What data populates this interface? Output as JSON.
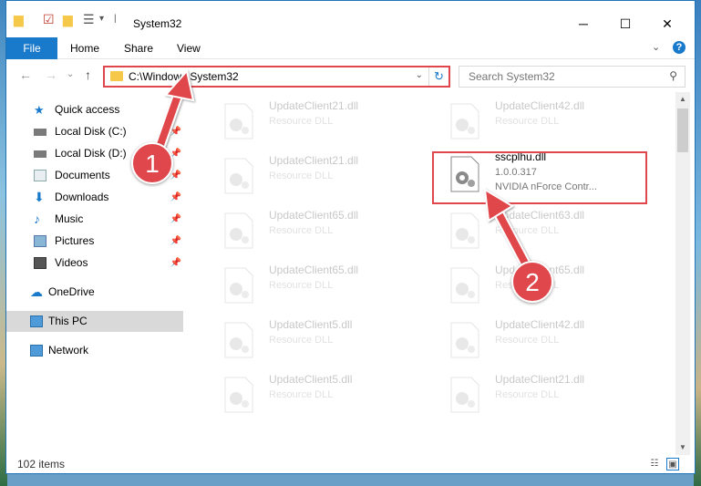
{
  "window": {
    "title": "System32",
    "minimize": "─",
    "maximize": "☐",
    "close": "✕"
  },
  "ribbon": {
    "tabs": [
      "File",
      "Home",
      "Share",
      "View"
    ],
    "expand_glyph": "⌄",
    "help_glyph": "?"
  },
  "nav": {
    "back_glyph": "←",
    "forward_glyph": "→",
    "recent_glyph": "⌄",
    "up_glyph": "↑",
    "address": "C:\\Windows\\System32",
    "search_placeholder": "Search System32"
  },
  "sidebar": {
    "items": [
      {
        "label": "Quick access",
        "icon": "star-icon",
        "pinned": false
      },
      {
        "label": "Local Disk (C:)",
        "icon": "drive-icon",
        "pinned": true
      },
      {
        "label": "Local Disk (D:)",
        "icon": "drive-icon",
        "pinned": true
      },
      {
        "label": "Documents",
        "icon": "documents-icon",
        "pinned": true
      },
      {
        "label": "Downloads",
        "icon": "download-icon",
        "pinned": true
      },
      {
        "label": "Music",
        "icon": "music-icon",
        "pinned": true
      },
      {
        "label": "Pictures",
        "icon": "pictures-icon",
        "pinned": true
      },
      {
        "label": "Videos",
        "icon": "videos-icon",
        "pinned": true
      },
      {
        "label": "OneDrive",
        "icon": "cloud-icon",
        "pinned": false
      },
      {
        "label": "This PC",
        "icon": "computer-icon",
        "pinned": false,
        "selected": true
      },
      {
        "label": "Network",
        "icon": "network-icon",
        "pinned": false
      }
    ]
  },
  "files": {
    "left": [
      {
        "name": "UpdateClient21.dll",
        "desc": "Resource DLL"
      },
      {
        "name": "UpdateClient21.dll",
        "desc": "Resource DLL"
      },
      {
        "name": "UpdateClient65.dll",
        "desc": "Resource DLL"
      },
      {
        "name": "UpdateClient65.dll",
        "desc": "Resource DLL"
      },
      {
        "name": "UpdateClient5.dll",
        "desc": "Resource DLL"
      },
      {
        "name": "UpdateClient5.dll",
        "desc": "Resource DLL"
      }
    ],
    "right": [
      {
        "name": "UpdateClient42.dll",
        "desc": "Resource DLL"
      },
      {
        "name": "UpdateClient63.dll",
        "desc": "Resource DLL"
      },
      {
        "name": "UpdateClient65.dll",
        "desc": "Resource DLL"
      },
      {
        "name": "UpdateClient42.dll",
        "desc": "Resource DLL"
      },
      {
        "name": "UpdateClient21.dll",
        "desc": "Resource DLL"
      }
    ],
    "highlighted": {
      "name": "sscplhu.dll",
      "version": "1.0.0.317",
      "desc": "NVIDIA nForce Contr..."
    }
  },
  "status": {
    "count": "102 items"
  },
  "annotations": {
    "badge1": "1",
    "badge2": "2",
    "color": "#e0474c"
  }
}
